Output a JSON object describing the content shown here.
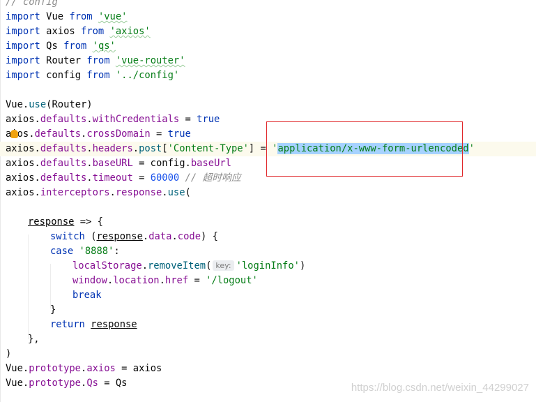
{
  "editor": {
    "top_comment": "// config",
    "lines": [
      {
        "kw": "import",
        "name": "Vue",
        "from": "from",
        "mod": "'vue'"
      },
      {
        "kw": "import",
        "name": "axios",
        "from": "from",
        "mod": "'axios'"
      },
      {
        "kw": "import",
        "name": "Qs",
        "from": "from",
        "mod": "'qs'"
      },
      {
        "kw": "import",
        "name": "Router",
        "from": "from",
        "mod": "'vue-router'"
      },
      {
        "kw": "import",
        "name": "config",
        "from": "from",
        "mod": "'../config'"
      }
    ],
    "use_line": {
      "obj": "Vue.",
      "fn": "use",
      "args": "(Router)"
    },
    "with_credentials": {
      "obj": "axios.",
      "p1": "defaults",
      "dot": ".",
      "p2": "withCredentials",
      "eq": " = ",
      "val": "true"
    },
    "cross_domain": {
      "obj_a": "a",
      "obj_b": "ios.",
      "p1": "defaults",
      "dot": ".",
      "p2": "crossDomain",
      "eq": " = ",
      "val": "true"
    },
    "content_type": {
      "obj": "axios.",
      "p1": "defaults",
      "p2": "headers",
      "p3": "post",
      "open": "[",
      "key": "'Content-Type'",
      "close": "] = ",
      "q1": "'",
      "value": "application/x-www-form-urlencoded",
      "q2": "'"
    },
    "base_url": {
      "obj": "axios.",
      "p1": "defaults",
      "p2": "baseURL",
      "eq": " = config.",
      "p3": "baseUrl"
    },
    "timeout": {
      "obj": "axios.",
      "p1": "defaults",
      "p2": "timeout",
      "eq": " = ",
      "num": "60000",
      "comment": "// 超时响应"
    },
    "interceptor": {
      "obj": "axios.",
      "p1": "interceptors",
      "p2": "response",
      "fn": "use",
      "tail": "("
    },
    "response_arrow": {
      "param": "response",
      "tail": " => {"
    },
    "switch_line": {
      "kw": "switch",
      "open": " (",
      "param": "response",
      "p1": "data",
      "p2": "code",
      "tail": ") {"
    },
    "case_line": {
      "kw": "case",
      "val": "'8888'",
      "tail": ":"
    },
    "storage_line": {
      "obj": "localStorage",
      "fn": "removeItem",
      "open": "(",
      "hint": "key:",
      "arg": "'loginInfo'",
      "close": ")"
    },
    "location_line": {
      "obj": "window",
      "p1": "location",
      "p2": "href",
      "eq": " = ",
      "val": "'/logout'"
    },
    "break_line": {
      "kw": "break"
    },
    "brace_close": "}",
    "return_line": {
      "kw": "return",
      "param": "response"
    },
    "close_arrow": "},",
    "close_paren": ")",
    "proto_axios": {
      "obj": "Vue.",
      "p1": "prototype",
      "p2": "axios",
      "tail": " = axios"
    },
    "proto_qs": {
      "obj": "Vue.",
      "p1": "prototype",
      "p2": "Qs",
      "tail": " = Qs"
    }
  },
  "watermark": "https://blog.csdn.net/weixin_44299027",
  "colors": {
    "keyword": "#0033b3",
    "string": "#067d17",
    "property": "#871094",
    "function": "#00627a",
    "number": "#1750eb",
    "comment": "#8c8c8c",
    "selection": "#a6d2ff",
    "annotation_box": "#e0272a"
  },
  "icons": [
    "intention-bulb-icon"
  ]
}
